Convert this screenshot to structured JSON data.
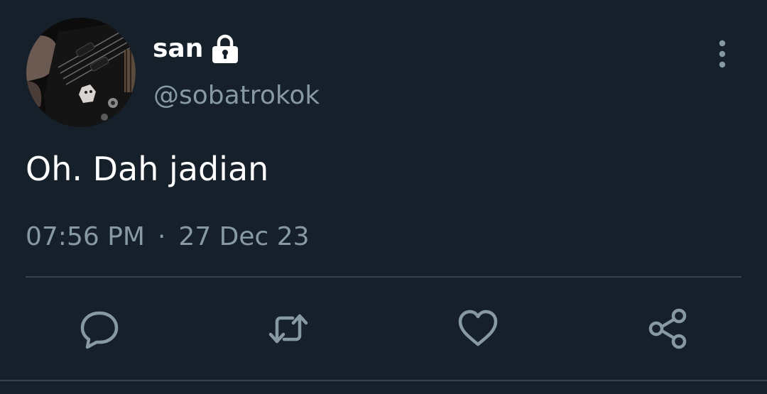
{
  "user": {
    "display_name": "san",
    "handle": "@sobatrokok",
    "protected_icon": "lock-icon",
    "avatar_icon": "avatar-guitar-photo"
  },
  "tweet": {
    "text": "Oh. Dah jadian",
    "time": "07:56 PM",
    "separator": "·",
    "date": "27 Dec 23"
  },
  "actions": [
    {
      "name": "reply",
      "icon": "reply-icon"
    },
    {
      "name": "retweet",
      "icon": "retweet-icon"
    },
    {
      "name": "like",
      "icon": "heart-icon"
    },
    {
      "name": "share",
      "icon": "share-icon"
    }
  ],
  "colors": {
    "background": "#15202b",
    "primary_text": "#ffffff",
    "secondary_text": "#8899a6",
    "divider": "#38444d"
  }
}
